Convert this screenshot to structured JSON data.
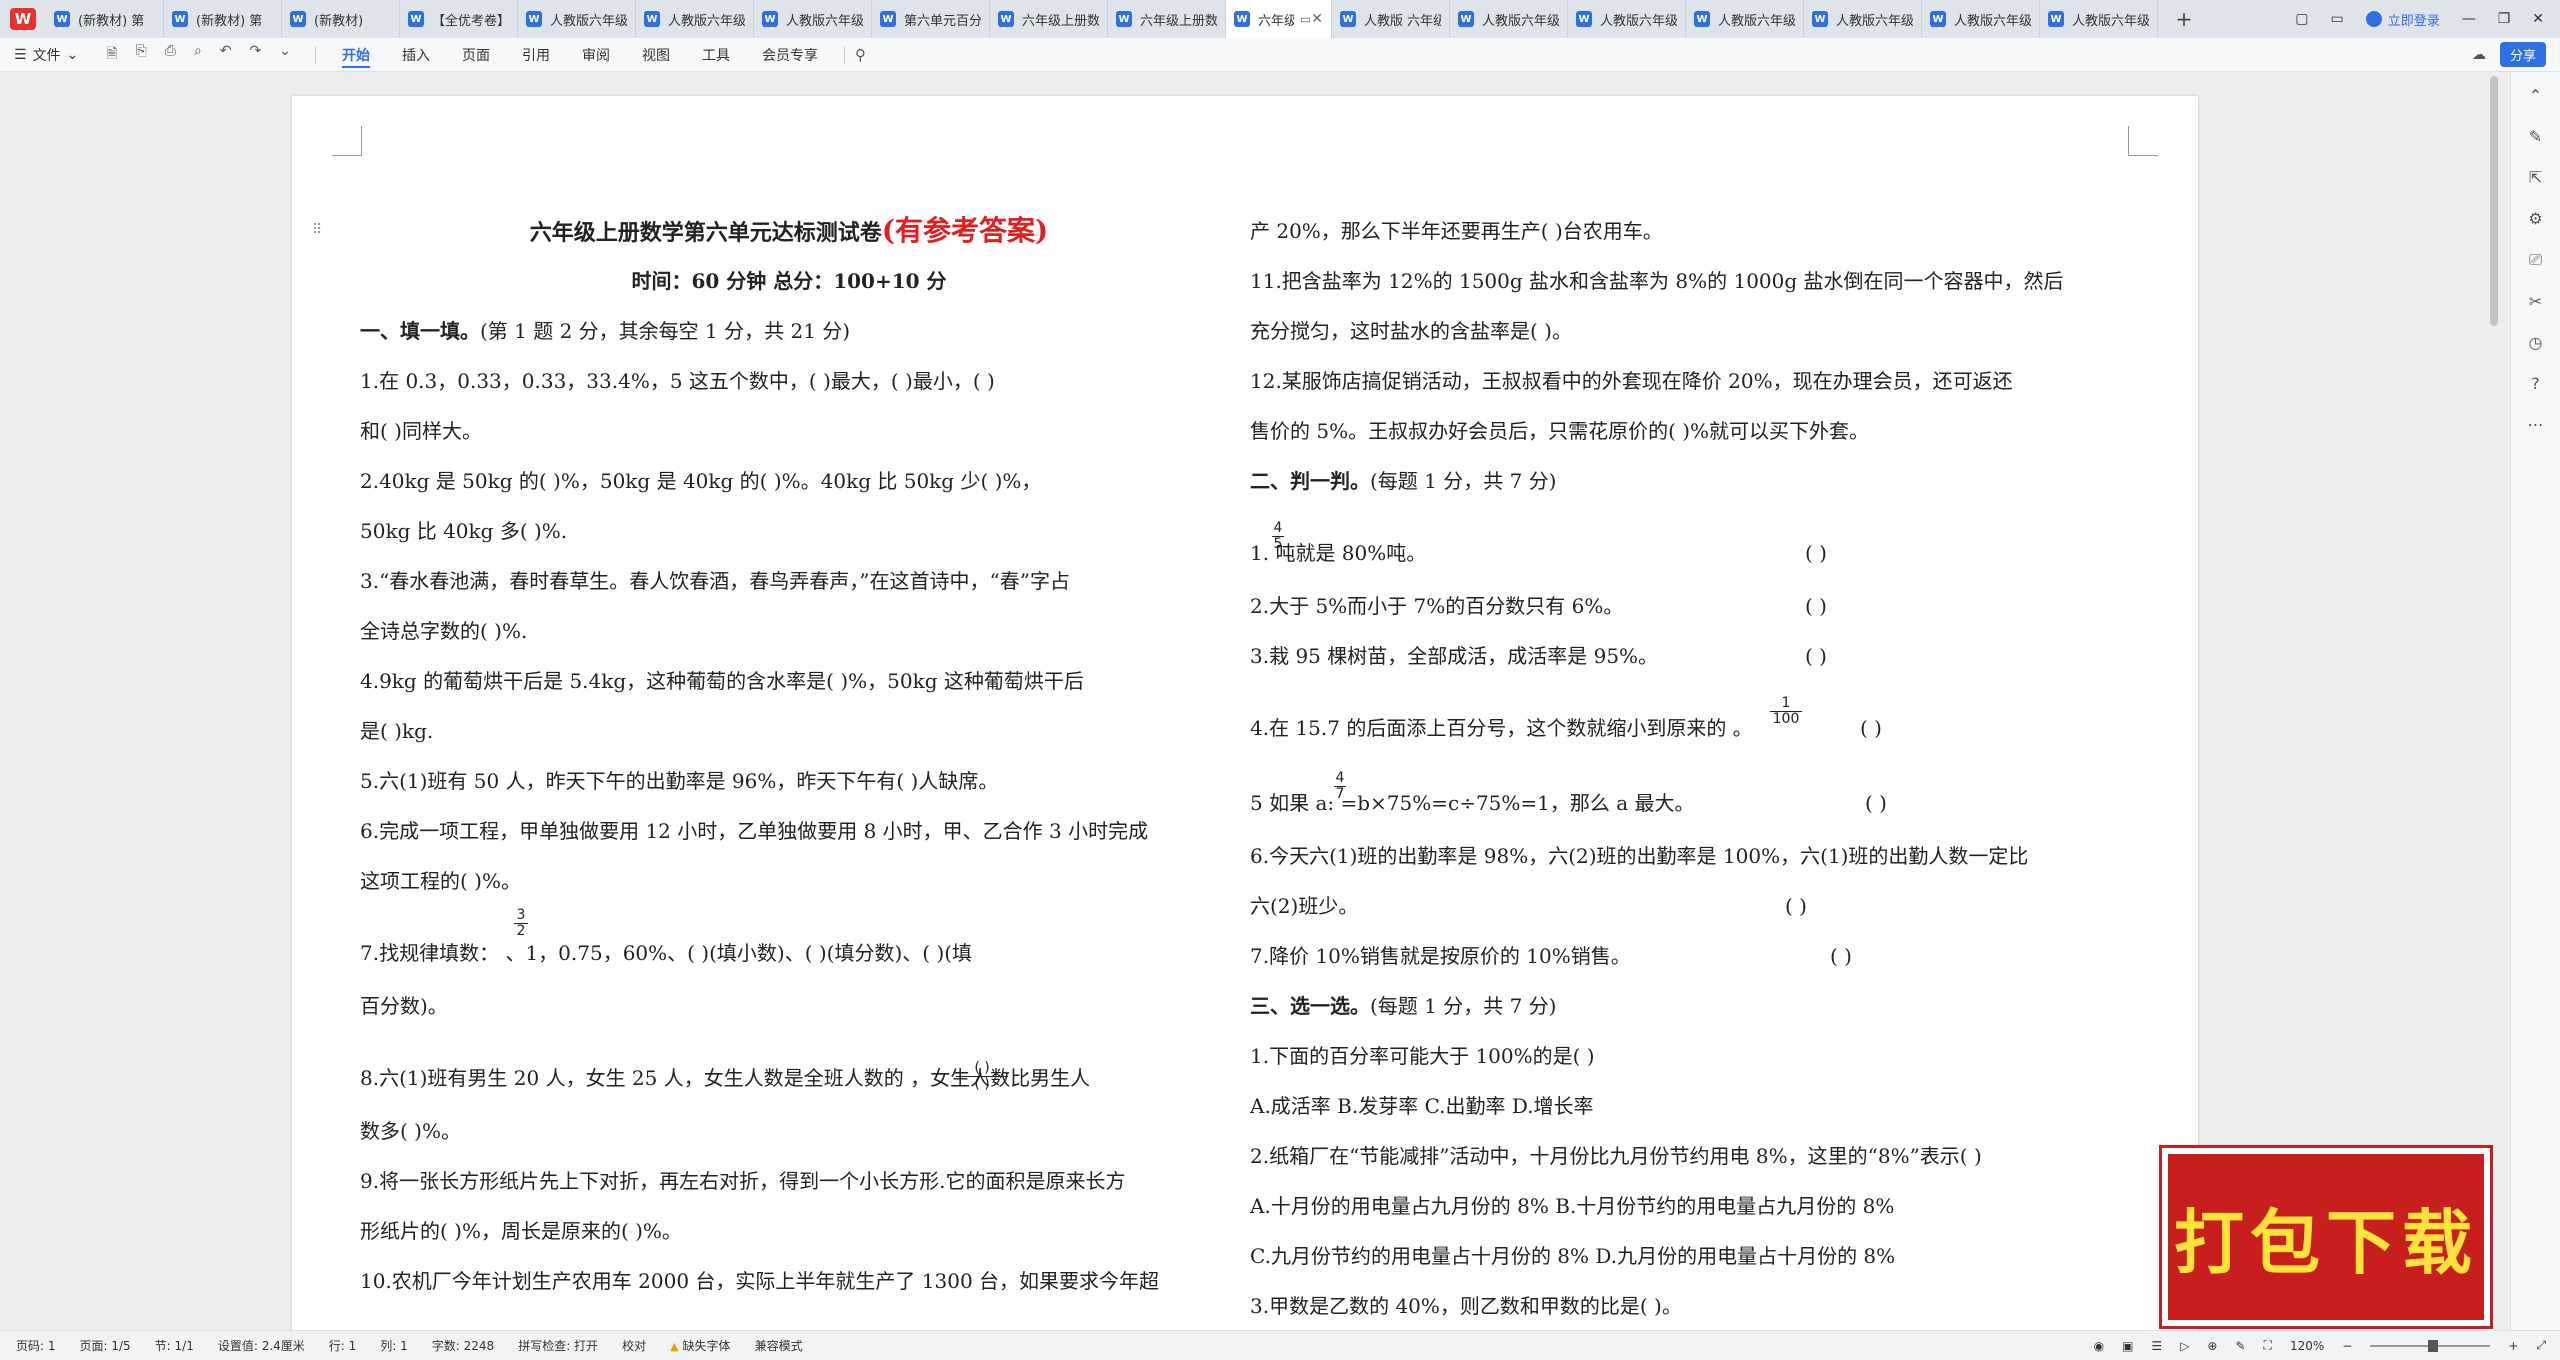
{
  "tabbar": {
    "tabs": [
      {
        "label": "(新教材) 第"
      },
      {
        "label": "(新教材) 第"
      },
      {
        "label": "(新教材)"
      },
      {
        "label": "【全优考卷】"
      },
      {
        "label": "人教版六年级"
      },
      {
        "label": "人教版六年级"
      },
      {
        "label": "人教版六年级"
      },
      {
        "label": "第六单元百分"
      },
      {
        "label": "六年级上册数"
      },
      {
        "label": "六年级上册数"
      },
      {
        "label": "六年级"
      },
      {
        "label": "人教版 六年级"
      },
      {
        "label": "人教版六年级"
      },
      {
        "label": "人教版六年级"
      },
      {
        "label": "人教版六年级"
      },
      {
        "label": "人教版六年级"
      },
      {
        "label": "人教版六年级"
      },
      {
        "label": "人教版六年级"
      }
    ],
    "active_index": 10,
    "login_label": "立即登录"
  },
  "ribbon": {
    "file_label": "文件",
    "menus": [
      "开始",
      "插入",
      "页面",
      "引用",
      "审阅",
      "视图",
      "工具",
      "会员专享"
    ],
    "share_label": "分享"
  },
  "doc": {
    "title": "六年级上册数学第六单元达标测试卷",
    "title_red": "(有参考答案)",
    "subtitle": "时间：60 分钟      总分：100+10 分",
    "left": [
      {
        "text": "一、填一填。",
        "note": "(第 1 题 2 分，其余每空 1 分，共 21 分)"
      },
      {
        "text": "1.在 0.3，0.33，0.33，33.4%，5 这五个数中，(          )最大，(          )最小，(          )"
      },
      {
        "text": "和(          )同样大。"
      },
      {
        "text": "2.40kg 是 50kg 的(        )%，50kg 是 40kg 的(          )%。40kg 比 50kg 少(        )%，"
      },
      {
        "text": "50kg 比 40kg 多(          )%."
      },
      {
        "text": "3.“春水春池满，春时春草生。春人饮春酒，春鸟弄春声，”在这首诗中，“春”字占"
      },
      {
        "text": "全诗总字数的(          )%."
      },
      {
        "text": "4.9kg 的葡萄烘干后是 5.4kg，这种葡萄的含水率是(          )%，50kg 这种葡萄烘干后"
      },
      {
        "text": "是(          )kg."
      },
      {
        "text": "5.六(1)班有 50 人，昨天下午的出勤率是 96%，昨天下午有(            )人缺席。"
      },
      {
        "text": "6.完成一项工程，甲单独做要用 12 小时，乙单独做要用 8 小时，甲、乙合作 3 小时完成"
      },
      {
        "text": "这项工程的(          )%。"
      },
      {
        "text": "7.找规律填数：  、1，0.75，60%、(        )(填小数)、(        )(填分数)、(          )(填"
      },
      {
        "text": "百分数)。"
      },
      {
        "text": "8.六(1)班有男生 20 人，女生 25 人，女生人数是全班人数的        ，女生人数比男生人"
      },
      {
        "text": "数多(            )%。"
      },
      {
        "text": "9.将一张长方形纸片先上下对折，再左右对折，得到一个小长方形.它的面积是原来长方"
      },
      {
        "text": "形纸片的(          )%，周长是原来的(            )%。"
      },
      {
        "text": "10.农机厂今年计划生产农用车 2000 台，实际上半年就生产了 1300 台，如果要求今年超"
      }
    ],
    "right": [
      {
        "text": "产 20%，那么下半年还要再生产(          )台农用车。"
      },
      {
        "text": "11.把含盐率为 12%的 1500g 盐水和含盐率为 8%的 1000g 盐水倒在同一个容器中，然后"
      },
      {
        "text": "充分搅匀，这时盐水的含盐率是(          )。"
      },
      {
        "text": "12.某服饰店搞促销活动，王叔叔看中的外套现在降价 20%，现在办理会员，还可返还"
      },
      {
        "text": "售价的 5%。王叔叔办好会员后，只需花原价的(          )%就可以买下外套。"
      },
      {
        "text": "二、判一判。",
        "note": "(每题 1 分，共 7 分)"
      },
      {
        "text": "1.  吨就是 80%吨。",
        "paren": "(        )"
      },
      {
        "text": "2.大于 5%而小于 7%的百分数只有 6%。",
        "paren": "(        )"
      },
      {
        "text": "3.栽 95 棵树苗，全部成活，成活率是 95%。",
        "paren": "(        )"
      },
      {
        "text": "4.在 15.7 的后面添上百分号，这个数就缩小到原来的    。",
        "paren": "(        )"
      },
      {
        "text": "5 如果 a:  =b×75%=c÷75%=1，那么 a 最大。",
        "paren": "(        )"
      },
      {
        "text": "6.今天六(1)班的出勤率是 98%，六(2)班的出勤率是 100%，六(1)班的出勤人数一定比"
      },
      {
        "text": "六(2)班少。",
        "paren": "(        )"
      },
      {
        "text": "7.降价 10%销售就是按原价的 10%销售。",
        "paren": "(        )"
      },
      {
        "text": "三、选一选。",
        "note": "(每题 1 分，共 7 分)"
      },
      {
        "text": "1.下面的百分率可能大于 100%的是(        )"
      },
      {
        "text": "A.成活率              B.发芽率              C.出勤率              D.增长率"
      },
      {
        "text": "2.纸箱厂在“节能减排”活动中，十月份比九月份节约用电 8%，这里的“8%”表示(        )"
      },
      {
        "text": "A.十月份的用电量占九月份的 8%        B.十月份节约的用电量占九月份的 8%"
      },
      {
        "text": "C.九月份节约的用电量占十月份的 8%   D.九月份的用电量占十月份的 8%"
      },
      {
        "text": "3.甲数是乙数的 40%，则乙数和甲数的比是(          )。"
      }
    ],
    "fractions": {
      "q7_num": "3",
      "q7_den": "2",
      "q8_num": "(    )",
      "q8_den": "(    )",
      "j1_num": "4",
      "j1_den": "5",
      "j4_num": "1",
      "j4_den": "100",
      "j5_num": "4",
      "j5_den": "7"
    }
  },
  "statusbar": {
    "page_num": "页码: 1",
    "pages": "页面: 1/5",
    "section": "节: 1/1",
    "setting": "设置值: 2.4厘米",
    "row": "行: 1",
    "col": "列: 1",
    "words": "字数: 2248",
    "spell": "拼写检查: 打开",
    "proof": "校对",
    "missing_font": "缺失字体",
    "compat": "兼容模式",
    "zoom": "120%"
  },
  "badge": {
    "label": "打包下载"
  }
}
